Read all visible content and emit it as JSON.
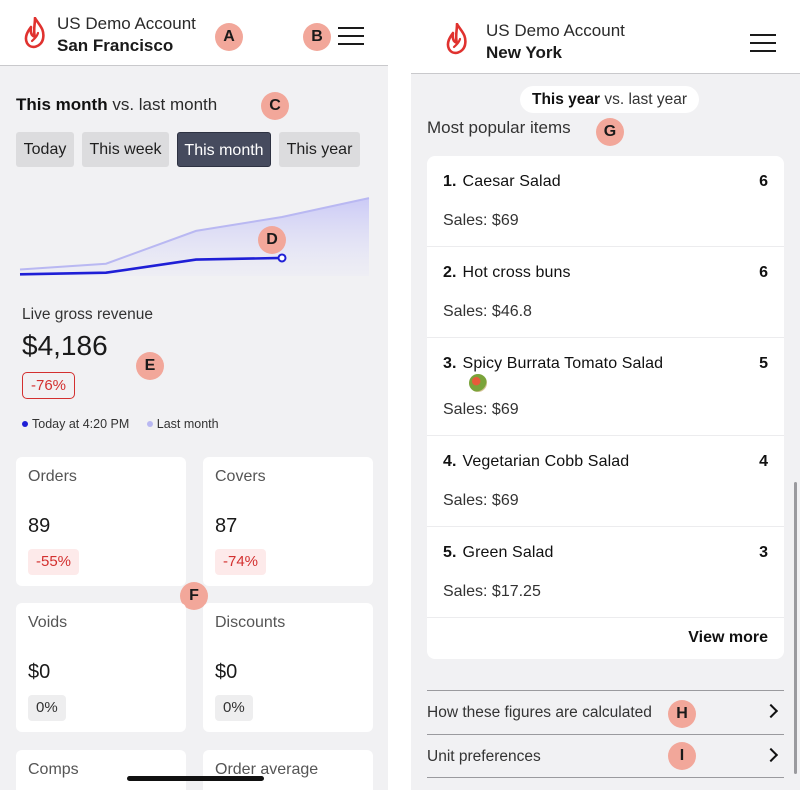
{
  "colors": {
    "accent": "#464b5e",
    "brand": "#e0322f",
    "annotation": "#f2a79a",
    "series_current": "#1f1fd6",
    "series_last": "#b9b8f2"
  },
  "left": {
    "account_name": "US Demo Account",
    "location": "San Francisco",
    "title_bold": "This month",
    "title_rest": " vs. last month",
    "tabs": [
      {
        "label": "Today",
        "active": false
      },
      {
        "label": "This week",
        "active": false
      },
      {
        "label": "This month",
        "active": true
      },
      {
        "label": "This year",
        "active": false
      }
    ],
    "revenue_label": "Live gross revenue",
    "revenue_value": "$4,186",
    "revenue_change": "-76%",
    "legend": {
      "current": "Today at 4:20 PM",
      "previous": "Last month"
    },
    "cards": [
      {
        "label": "Orders",
        "value": "89",
        "change": "-55%",
        "tone": "neg"
      },
      {
        "label": "Covers",
        "value": "87",
        "change": "-74%",
        "tone": "neg"
      },
      {
        "label": "Voids",
        "value": "$0",
        "change": "0%",
        "tone": "zero"
      },
      {
        "label": "Discounts",
        "value": "$0",
        "change": "0%",
        "tone": "zero"
      },
      {
        "label": "Comps"
      },
      {
        "label": "Order average"
      }
    ]
  },
  "right": {
    "account_name": "US Demo Account",
    "location": "New York",
    "pill_bold": "This year",
    "pill_rest": " vs. last year",
    "section_title": "Most popular items",
    "items": [
      {
        "rank": "1.",
        "name": "Caesar Salad",
        "qty": "6",
        "sales": "Sales: $69"
      },
      {
        "rank": "2.",
        "name": "Hot cross buns",
        "qty": "6",
        "sales": "Sales: $46.8"
      },
      {
        "rank": "3.",
        "name": "Spicy Burrata Tomato Salad",
        "qty": "5",
        "sales": "Sales: $69",
        "has_thumb": true
      },
      {
        "rank": "4.",
        "name": "Vegetarian Cobb Salad",
        "qty": "4",
        "sales": "Sales: $69"
      },
      {
        "rank": "5.",
        "name": "Green Salad",
        "qty": "3",
        "sales": "Sales: $17.25"
      }
    ],
    "view_more": "View more",
    "links": [
      "How these figures are calculated",
      "Unit preferences"
    ]
  },
  "annotations": [
    "A",
    "B",
    "C",
    "D",
    "E",
    "F",
    "G",
    "H",
    "I"
  ],
  "chart_data": {
    "type": "area",
    "series": [
      {
        "values": [
          0.08,
          0.15,
          0.55,
          0.72,
          0.95
        ]
      },
      {
        "values": [
          0.02,
          0.04,
          0.2,
          0.22
        ]
      }
    ]
  }
}
